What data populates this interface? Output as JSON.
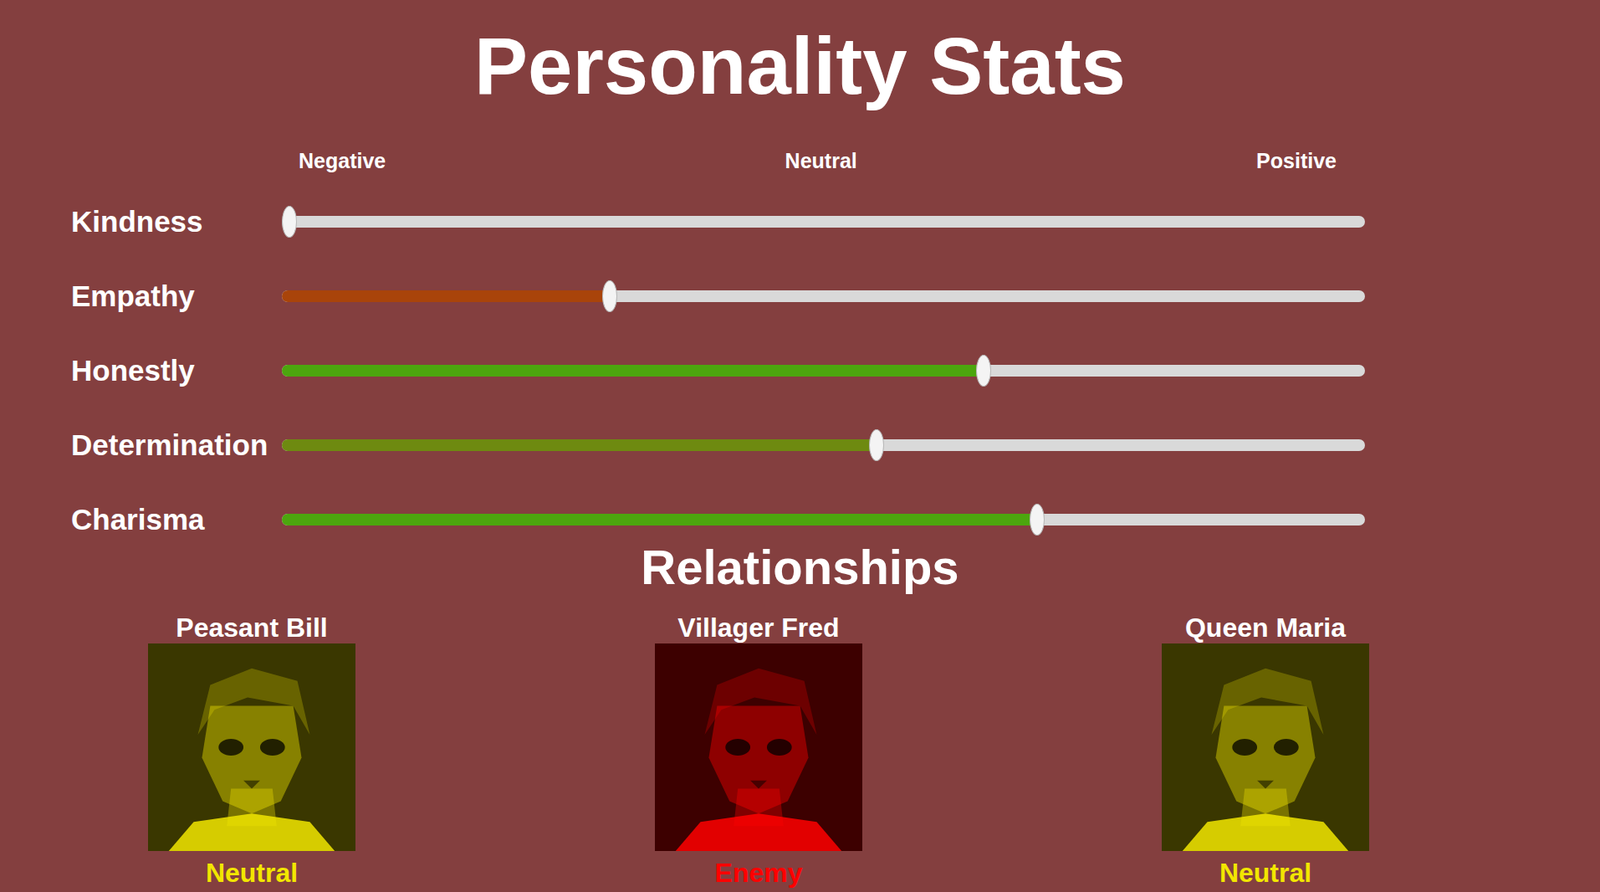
{
  "title": "Personality Stats",
  "scale": {
    "negative": "Negative",
    "neutral": "Neutral",
    "positive": "Positive"
  },
  "stats": [
    {
      "name": "Kindness",
      "level": 0,
      "color": "#b0200f"
    },
    {
      "name": "Empathy",
      "level": 0.3,
      "color": "#a9440a"
    },
    {
      "name": "Honestly",
      "level": 0.65,
      "color": "#4ca60e"
    },
    {
      "name": "Determination",
      "level": 0.55,
      "color": "#6e8a10"
    },
    {
      "name": "Charisma",
      "level": 0.7,
      "color": "#4ca60e"
    }
  ],
  "relationships_title": "Relationships",
  "relationships": [
    {
      "name": "Peasant Bill",
      "status": "Neutral",
      "color": "#f2e600"
    },
    {
      "name": "Villager Fred",
      "status": "Enemy",
      "color": "#ff0000"
    },
    {
      "name": "Queen Maria",
      "status": "Neutral",
      "color": "#f2e600"
    }
  ]
}
